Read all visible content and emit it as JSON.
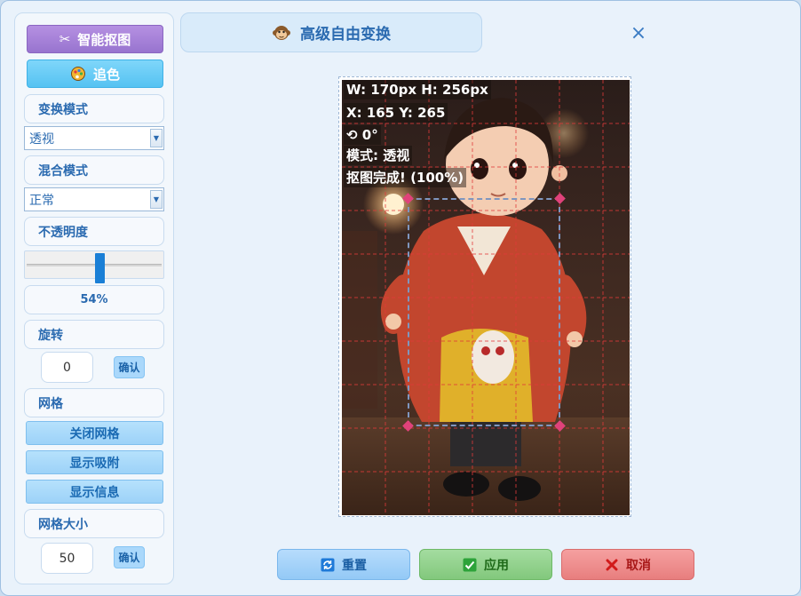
{
  "header": {
    "title": "高级自由变换",
    "close_symbol": "×"
  },
  "left_panel": {
    "smart_cutout": "智能抠图",
    "color_button": "追色",
    "transform_mode_label": "变换模式",
    "transform_mode_value": "透视",
    "blend_mode_label": "混合模式",
    "blend_mode_value": "正常",
    "opacity_label": "不透明度",
    "opacity_percent": 54,
    "opacity_value_text": "54%",
    "rotation_label": "旋转",
    "rotation_value": "0",
    "rotation_confirm": "确认",
    "grid_label": "网格",
    "grid_close": "关闭网格",
    "show_snap": "显示吸附",
    "show_info": "显示信息",
    "grid_size_label": "网格大小",
    "grid_size_value": "50",
    "grid_size_confirm": "确认"
  },
  "canvas": {
    "info": {
      "size": "W: 170px H: 256px",
      "position": "X: 165 Y: 265",
      "rotation": "⟲ 0°",
      "mode": "模式: 透视",
      "status": "抠图完成! (100%)"
    }
  },
  "footer": {
    "reset": "重置",
    "apply": "应用",
    "cancel": "取消"
  },
  "colors": {
    "accent": "#2a6ab0",
    "grid_line": "#e23a3a",
    "handle": "#e0427a"
  }
}
